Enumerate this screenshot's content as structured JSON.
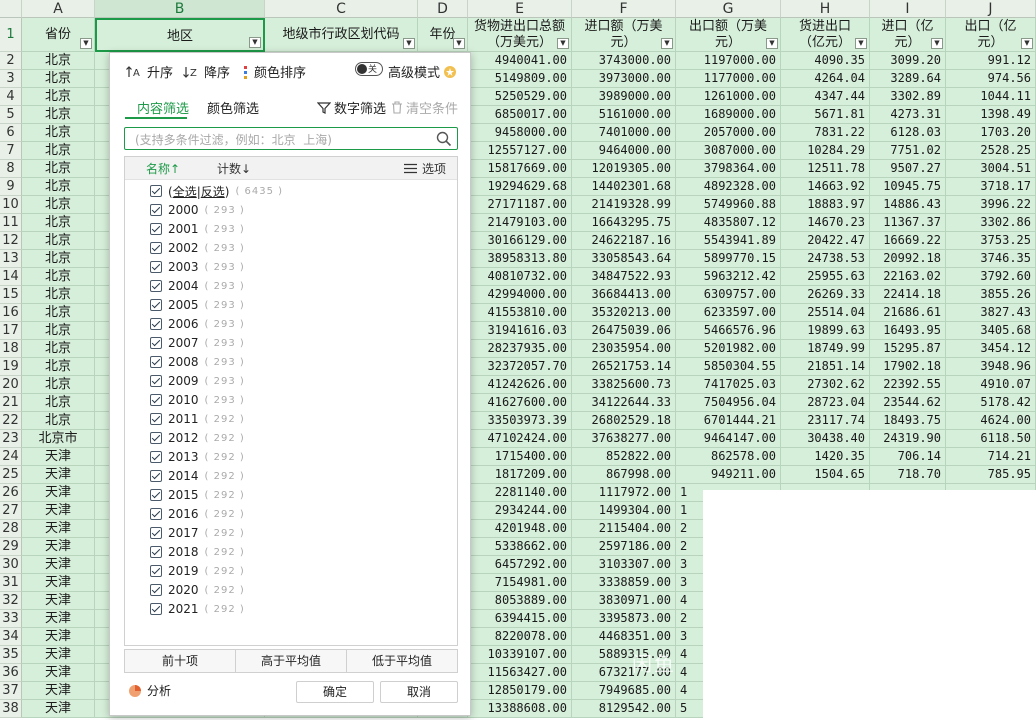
{
  "sheet": {
    "columns": [
      "A",
      "B",
      "C",
      "D",
      "E",
      "F",
      "G",
      "H",
      "I",
      "J"
    ],
    "headers": [
      "省份",
      "地区",
      "地级市行政区划代码",
      "年份",
      "货物进出口总额（万美元）",
      "进口额（万美元）",
      "出口额（万美元）",
      "货进出口（亿元）",
      "进口（亿元）",
      "出口（亿元）"
    ],
    "header_lines": [
      [
        "省份"
      ],
      [
        "地区"
      ],
      [
        "地级市行政区划代码"
      ],
      [
        "年份"
      ],
      [
        "货物进出口总额",
        "（万美元）"
      ],
      [
        "进口额（万美",
        "元）"
      ],
      [
        "出口额（万美",
        "元）"
      ],
      [
        "货进出口",
        "（亿元）"
      ],
      [
        "进口（亿",
        "元）"
      ],
      [
        "出口（亿",
        "元）"
      ]
    ],
    "row_numbers": [
      "1",
      "2",
      "3",
      "4",
      "5",
      "6",
      "7",
      "8",
      "9",
      "10",
      "11",
      "12",
      "13",
      "14",
      "15",
      "16",
      "17",
      "18",
      "19",
      "20",
      "21",
      "22",
      "23",
      "24",
      "25",
      "26",
      "27",
      "28",
      "29",
      "30",
      "31",
      "32",
      "33",
      "34",
      "35",
      "36",
      "37",
      "38"
    ],
    "rows": [
      {
        "prov": "北京",
        "e": "4940041.00",
        "f": "3743000.00",
        "g": "1197000.00",
        "h": "4090.35",
        "i": "3099.20",
        "j": "991.12"
      },
      {
        "prov": "北京",
        "e": "5149809.00",
        "f": "3973000.00",
        "g": "1177000.00",
        "h": "4264.04",
        "i": "3289.64",
        "j": "974.56"
      },
      {
        "prov": "北京",
        "e": "5250529.00",
        "f": "3989000.00",
        "g": "1261000.00",
        "h": "4347.44",
        "i": "3302.89",
        "j": "1044.11"
      },
      {
        "prov": "北京",
        "e": "6850017.00",
        "f": "5161000.00",
        "g": "1689000.00",
        "h": "5671.81",
        "i": "4273.31",
        "j": "1398.49"
      },
      {
        "prov": "北京",
        "e": "9458000.00",
        "f": "7401000.00",
        "g": "2057000.00",
        "h": "7831.22",
        "i": "6128.03",
        "j": "1703.20"
      },
      {
        "prov": "北京",
        "e": "12557127.00",
        "f": "9464000.00",
        "g": "3087000.00",
        "h": "10284.29",
        "i": "7751.02",
        "j": "2528.25"
      },
      {
        "prov": "北京",
        "e": "15817669.00",
        "f": "12019305.00",
        "g": "3798364.00",
        "h": "12511.78",
        "i": "9507.27",
        "j": "3004.51"
      },
      {
        "prov": "北京",
        "e": "19294629.68",
        "f": "14402301.68",
        "g": "4892328.00",
        "h": "14663.92",
        "i": "10945.75",
        "j": "3718.17"
      },
      {
        "prov": "北京",
        "e": "27171187.00",
        "f": "21419328.99",
        "g": "5749960.88",
        "h": "18883.97",
        "i": "14886.43",
        "j": "3996.22"
      },
      {
        "prov": "北京",
        "e": "21479103.00",
        "f": "16643295.75",
        "g": "4835807.12",
        "h": "14670.23",
        "i": "11367.37",
        "j": "3302.86"
      },
      {
        "prov": "北京",
        "e": "30166129.00",
        "f": "24622187.16",
        "g": "5543941.89",
        "h": "20422.47",
        "i": "16669.22",
        "j": "3753.25"
      },
      {
        "prov": "北京",
        "e": "38958313.80",
        "f": "33058543.64",
        "g": "5899770.15",
        "h": "24738.53",
        "i": "20992.18",
        "j": "3746.35"
      },
      {
        "prov": "北京",
        "e": "40810732.00",
        "f": "34847522.93",
        "g": "5963212.42",
        "h": "25955.63",
        "i": "22163.02",
        "j": "3792.60"
      },
      {
        "prov": "北京",
        "e": "42994000.00",
        "f": "36684413.00",
        "g": "6309757.00",
        "h": "26269.33",
        "i": "22414.18",
        "j": "3855.26"
      },
      {
        "prov": "北京",
        "e": "41553810.00",
        "f": "35320213.00",
        "g": "6233597.00",
        "h": "25514.04",
        "i": "21686.61",
        "j": "3827.43"
      },
      {
        "prov": "北京",
        "e": "31941616.03",
        "f": "26475039.06",
        "g": "5466576.96",
        "h": "19899.63",
        "i": "16493.95",
        "j": "3405.68"
      },
      {
        "prov": "北京",
        "e": "28237935.00",
        "f": "23035954.00",
        "g": "5201982.00",
        "h": "18749.99",
        "i": "15295.87",
        "j": "3454.12"
      },
      {
        "prov": "北京",
        "e": "32372057.70",
        "f": "26521753.14",
        "g": "5850304.55",
        "h": "21851.14",
        "i": "17902.18",
        "j": "3948.96"
      },
      {
        "prov": "北京",
        "e": "41242626.00",
        "f": "33825600.73",
        "g": "7417025.03",
        "h": "27302.62",
        "i": "22392.55",
        "j": "4910.07"
      },
      {
        "prov": "北京",
        "e": "41627600.00",
        "f": "34122644.33",
        "g": "7504956.04",
        "h": "28723.04",
        "i": "23544.62",
        "j": "5178.42"
      },
      {
        "prov": "北京",
        "e": "33503973.39",
        "f": "26802529.18",
        "g": "6701444.21",
        "h": "23117.74",
        "i": "18493.75",
        "j": "4624.00"
      },
      {
        "prov": "北京市",
        "e": "47102424.00",
        "f": "37638277.00",
        "g": "9464147.00",
        "h": "30438.40",
        "i": "24319.90",
        "j": "6118.50"
      },
      {
        "prov": "天津",
        "e": "1715400.00",
        "f": "852822.00",
        "g": "862578.00",
        "h": "1420.35",
        "i": "706.14",
        "j": "714.21"
      },
      {
        "prov": "天津",
        "e": "1817209.00",
        "f": "867998.00",
        "g": "949211.00",
        "h": "1504.65",
        "i": "718.70",
        "j": "785.95"
      },
      {
        "prov": "天津",
        "e": "2281140.00",
        "f": "1117972.00",
        "g": "1",
        "h": "",
        "i": "",
        "j": ""
      },
      {
        "prov": "天津",
        "e": "2934244.00",
        "f": "1499304.00",
        "g": "1",
        "h": "",
        "i": "",
        "j": ""
      },
      {
        "prov": "天津",
        "e": "4201948.00",
        "f": "2115404.00",
        "g": "2",
        "h": "",
        "i": "",
        "j": ""
      },
      {
        "prov": "天津",
        "e": "5338662.00",
        "f": "2597186.00",
        "g": "2",
        "h": "",
        "i": "",
        "j": ""
      },
      {
        "prov": "天津",
        "e": "6457292.00",
        "f": "3103307.00",
        "g": "3",
        "h": "",
        "i": "",
        "j": ""
      },
      {
        "prov": "天津",
        "e": "7154981.00",
        "f": "3338859.00",
        "g": "3",
        "h": "",
        "i": "",
        "j": ""
      },
      {
        "prov": "天津",
        "e": "8053889.00",
        "f": "3830971.00",
        "g": "4",
        "h": "",
        "i": "",
        "j": ""
      },
      {
        "prov": "天津",
        "e": "6394415.00",
        "f": "3395873.00",
        "g": "2",
        "h": "",
        "i": "",
        "j": ""
      },
      {
        "prov": "天津",
        "e": "8220078.00",
        "f": "4468351.00",
        "g": "3",
        "h": "",
        "i": "",
        "j": ""
      },
      {
        "prov": "天津",
        "e": "10339107.00",
        "f": "5889315.00",
        "g": "4",
        "h": "",
        "i": "",
        "j": ""
      },
      {
        "prov": "天津",
        "e": "11563427.00",
        "f": "6732177.00",
        "g": "4",
        "h": "",
        "i": "",
        "j": ""
      },
      {
        "prov": "天津",
        "e": "12850179.00",
        "f": "7949685.00",
        "g": "4",
        "h": "",
        "i": "",
        "j": ""
      },
      {
        "prov": "天津",
        "e": "13388608.00",
        "f": "8129542.00",
        "g": "5",
        "h": "",
        "i": "",
        "j": ""
      }
    ],
    "watermark": "闲鱼"
  },
  "filter": {
    "sort_asc": "升序",
    "sort_desc": "降序",
    "color_sort": "颜色排序",
    "toggle_state": "关",
    "advanced_mode": "高级模式",
    "tab_content": "内容筛选",
    "tab_color": "颜色筛选",
    "number_filter": "数字筛选",
    "clear_condition": "清空条件",
    "search_placeholder": "(支持多条件过滤，例如：北京  上海)",
    "list_name_header": "名称↑",
    "list_count_header": "计数↓",
    "options_label": "选项",
    "select_all": "全选",
    "invert": "反选",
    "select_all_count": "( 6435 )",
    "items": [
      {
        "label": "2000",
        "count": "( 293 )"
      },
      {
        "label": "2001",
        "count": "( 293 )"
      },
      {
        "label": "2002",
        "count": "( 293 )"
      },
      {
        "label": "2003",
        "count": "( 293 )"
      },
      {
        "label": "2004",
        "count": "( 293 )"
      },
      {
        "label": "2005",
        "count": "( 293 )"
      },
      {
        "label": "2006",
        "count": "( 293 )"
      },
      {
        "label": "2007",
        "count": "( 293 )"
      },
      {
        "label": "2008",
        "count": "( 293 )"
      },
      {
        "label": "2009",
        "count": "( 293 )"
      },
      {
        "label": "2010",
        "count": "( 293 )"
      },
      {
        "label": "2011",
        "count": "( 292 )"
      },
      {
        "label": "2012",
        "count": "( 292 )"
      },
      {
        "label": "2013",
        "count": "( 292 )"
      },
      {
        "label": "2014",
        "count": "( 292 )"
      },
      {
        "label": "2015",
        "count": "( 292 )"
      },
      {
        "label": "2016",
        "count": "( 292 )"
      },
      {
        "label": "2017",
        "count": "( 292 )"
      },
      {
        "label": "2018",
        "count": "( 292 )"
      },
      {
        "label": "2019",
        "count": "( 292 )"
      },
      {
        "label": "2020",
        "count": "( 292 )"
      },
      {
        "label": "2021",
        "count": "( 292 )"
      }
    ],
    "top10": "前十项",
    "above_avg": "高于平均值",
    "below_avg": "低于平均值",
    "analysis": "分析",
    "ok": "确定",
    "cancel": "取消",
    "accent_color": "#1d9a48"
  }
}
